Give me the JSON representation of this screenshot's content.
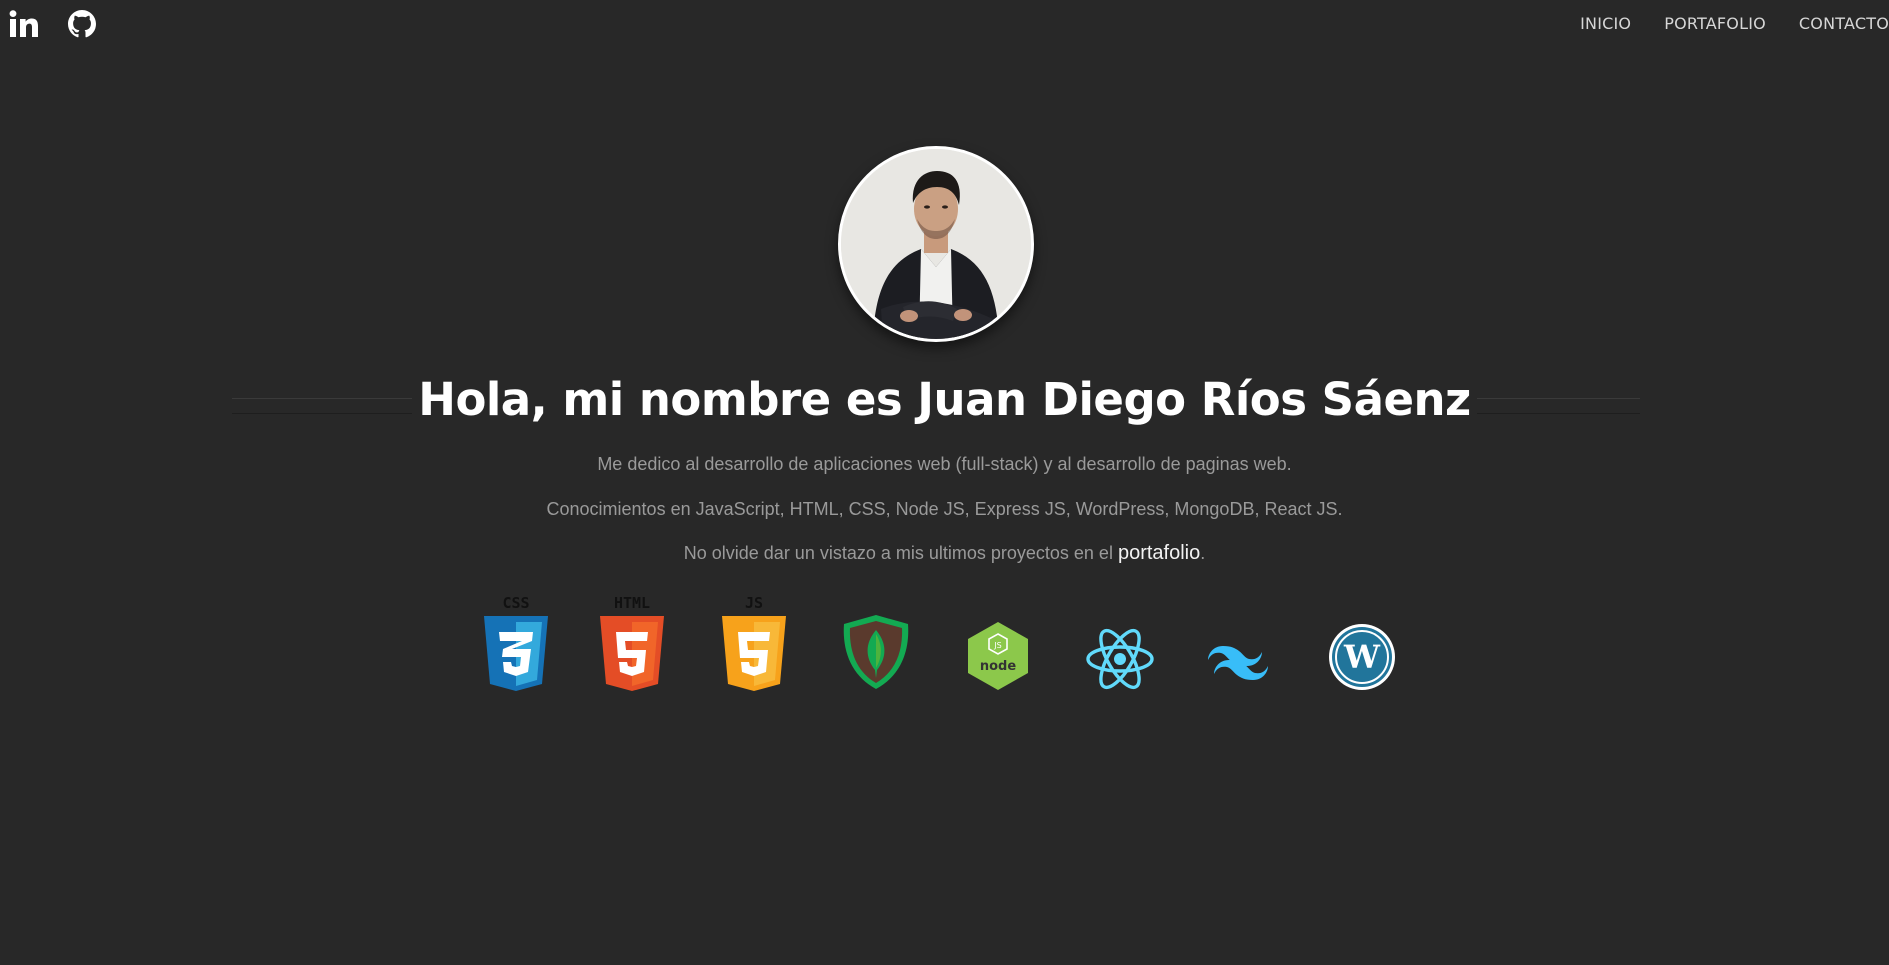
{
  "header": {
    "social": [
      {
        "icon": "linkedin-icon"
      },
      {
        "icon": "github-icon"
      }
    ],
    "nav": [
      "INICIO",
      "PORTAFOLIO",
      "CONTACTO"
    ]
  },
  "hero": {
    "avatar": "profile-photo",
    "title": "Hola, mi nombre es Juan Diego Ríos Sáenz",
    "p1": "Me dedico al desarrollo de aplicaciones web (full-stack) y al desarrollo de paginas web.",
    "p2": "Conocimientos en JavaScript, HTML, CSS, Node JS, Express JS, WordPress, MongoDB, React JS.",
    "p3_before": "No olvide dar un vistazo a mis ultimos proyectos en el ",
    "p3_link": "portafolio",
    "p3_after": "."
  },
  "tech": {
    "css_label": "CSS",
    "html_label": "HTML",
    "js_label": "JS",
    "icons": [
      "css3-icon",
      "html5-icon",
      "javascript-icon",
      "mongodb-icon",
      "nodejs-icon",
      "react-icon",
      "tailwind-icon",
      "wordpress-icon"
    ]
  },
  "colors": {
    "background": "#282828",
    "css": "#1572b6",
    "html": "#e44d26",
    "js": "#f7a21b",
    "mongodb": "#13aa52",
    "node": "#8cc84b",
    "react": "#61dafb",
    "tailwind": "#38bdf8",
    "wordpress": "#21759b"
  }
}
